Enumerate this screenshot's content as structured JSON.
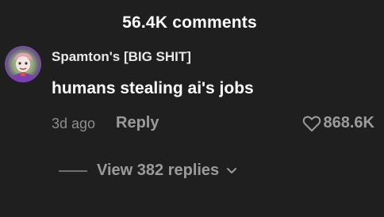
{
  "header": {
    "title": "56.4K comments"
  },
  "comment": {
    "username": "Spamton's [BIG SHIT]",
    "text": "humans stealing ai's jobs",
    "time": "3d ago",
    "reply_label": "Reply",
    "like_count": "868.6K",
    "like_icon": "heart-outline-icon",
    "view_replies_label": "View 382 replies",
    "view_replies_icon": "chevron-down-icon"
  },
  "colors": {
    "background": "#1f1f1f",
    "primary_text": "#ffffff",
    "secondary_text": "#9b9b9b"
  }
}
